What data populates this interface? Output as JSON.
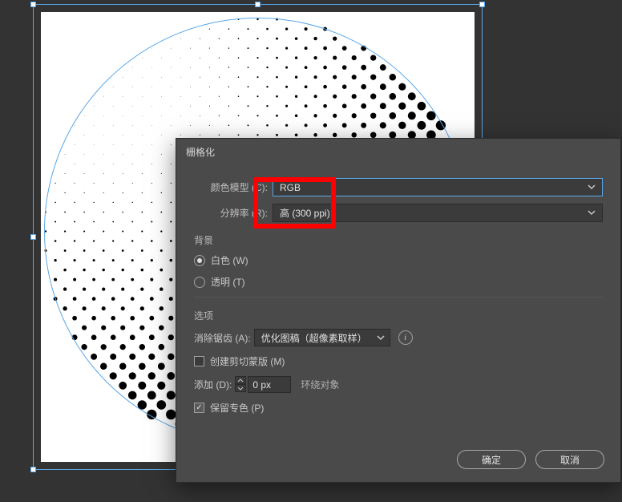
{
  "dialog": {
    "title": "栅格化",
    "color_model": {
      "label": "颜色模型 (C):",
      "value": "RGB"
    },
    "resolution": {
      "label": "分辨率 (R):",
      "value": "高 (300 ppi)"
    },
    "background": {
      "title": "背景",
      "white": "白色 (W)",
      "transparent": "透明 (T)"
    },
    "options": {
      "title": "选项",
      "antialias_label": "消除锯齿 (A):",
      "antialias_value": "优化图稿（超像素取样）",
      "clipping_mask": "创建剪切蒙版 (M)",
      "add_label": "添加 (D):",
      "add_value": "0 px",
      "around": "环绕对象",
      "preserve_spot": "保留专色 (P)"
    },
    "ok": "确定",
    "cancel": "取消"
  }
}
